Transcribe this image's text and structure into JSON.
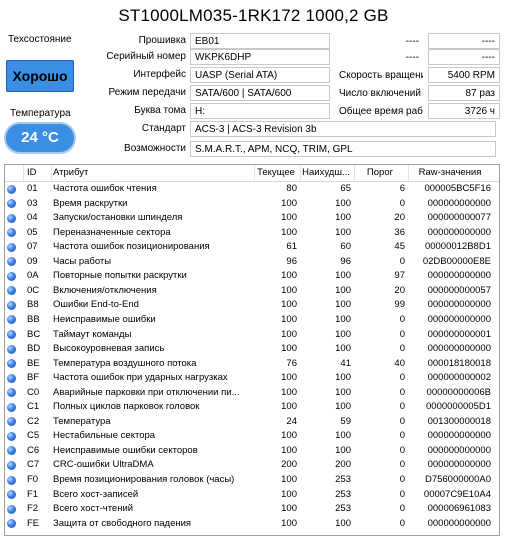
{
  "title": "ST1000LM035-1RK172 1000,2 GB",
  "health": {
    "label": "Техсостояние",
    "status": "Хорошо"
  },
  "temperature": {
    "label": "Температура",
    "value": "24 °C"
  },
  "info_left": [
    {
      "label": "Прошивка",
      "value": "EB01"
    },
    {
      "label": "Серийный номер",
      "value": "WKPK6DHP"
    },
    {
      "label": "Интерфейс",
      "value": "UASP (Serial ATA)"
    },
    {
      "label": "Режим передачи",
      "value": "SATA/600 | SATA/600"
    },
    {
      "label": "Буква тома",
      "value": "H:"
    },
    {
      "label": "Стандарт",
      "value": "ACS-3 | ACS-3 Revision 3b"
    },
    {
      "label": "Возможности",
      "value": "S.M.A.R.T., APM, NCQ, TRIM, GPL"
    }
  ],
  "info_right": [
    {
      "label": "----",
      "value": "----"
    },
    {
      "label": "----",
      "value": "----"
    },
    {
      "label": "Скорость вращения",
      "value": "5400 RPM"
    },
    {
      "label": "Число включений",
      "value": "87 раз"
    },
    {
      "label": "Общее время работы",
      "value": "3726 ч"
    }
  ],
  "table": {
    "headers": {
      "id": "ID",
      "name": "Атрибут",
      "current": "Текущее",
      "worst": "Наихудш...",
      "threshold": "Порог",
      "raw": "Raw-значения"
    },
    "status_icon": "blue-circle-icon",
    "rows": [
      {
        "id": "01",
        "name": "Частота ошибок чтения",
        "current": "80",
        "worst": "65",
        "threshold": "6",
        "raw": "000005BC5F16"
      },
      {
        "id": "03",
        "name": "Время раскрутки",
        "current": "100",
        "worst": "100",
        "threshold": "0",
        "raw": "000000000000"
      },
      {
        "id": "04",
        "name": "Запуски/остановки шпинделя",
        "current": "100",
        "worst": "100",
        "threshold": "20",
        "raw": "000000000077"
      },
      {
        "id": "05",
        "name": "Переназначенные сектора",
        "current": "100",
        "worst": "100",
        "threshold": "36",
        "raw": "000000000000"
      },
      {
        "id": "07",
        "name": "Частота ошибок позиционирования",
        "current": "61",
        "worst": "60",
        "threshold": "45",
        "raw": "00000012B8D1"
      },
      {
        "id": "09",
        "name": "Часы работы",
        "current": "96",
        "worst": "96",
        "threshold": "0",
        "raw": "02DB00000E8E"
      },
      {
        "id": "0A",
        "name": "Повторные попытки раскрутки",
        "current": "100",
        "worst": "100",
        "threshold": "97",
        "raw": "000000000000"
      },
      {
        "id": "0C",
        "name": "Включения/отключения",
        "current": "100",
        "worst": "100",
        "threshold": "20",
        "raw": "000000000057"
      },
      {
        "id": "B8",
        "name": "Ошибки End-to-End",
        "current": "100",
        "worst": "100",
        "threshold": "99",
        "raw": "000000000000"
      },
      {
        "id": "BB",
        "name": "Неисправимые ошибки",
        "current": "100",
        "worst": "100",
        "threshold": "0",
        "raw": "000000000000"
      },
      {
        "id": "BC",
        "name": "Таймаут команды",
        "current": "100",
        "worst": "100",
        "threshold": "0",
        "raw": "000000000001"
      },
      {
        "id": "BD",
        "name": "Высокоуровневая запись",
        "current": "100",
        "worst": "100",
        "threshold": "0",
        "raw": "000000000000"
      },
      {
        "id": "BE",
        "name": "Температура воздушного потока",
        "current": "76",
        "worst": "41",
        "threshold": "40",
        "raw": "000018180018"
      },
      {
        "id": "BF",
        "name": "Частота ошибок при ударных нагрузках",
        "current": "100",
        "worst": "100",
        "threshold": "0",
        "raw": "000000000002"
      },
      {
        "id": "C0",
        "name": "Аварийные парковки при отключении пи...",
        "current": "100",
        "worst": "100",
        "threshold": "0",
        "raw": "00000000006B"
      },
      {
        "id": "C1",
        "name": "Полных циклов парковок головок",
        "current": "100",
        "worst": "100",
        "threshold": "0",
        "raw": "0000000005D1"
      },
      {
        "id": "C2",
        "name": "Температура",
        "current": "24",
        "worst": "59",
        "threshold": "0",
        "raw": "001300000018"
      },
      {
        "id": "C5",
        "name": "Нестабильные сектора",
        "current": "100",
        "worst": "100",
        "threshold": "0",
        "raw": "000000000000"
      },
      {
        "id": "C6",
        "name": "Неисправимые ошибки секторов",
        "current": "100",
        "worst": "100",
        "threshold": "0",
        "raw": "000000000000"
      },
      {
        "id": "C7",
        "name": "CRC-ошибки UltraDMA",
        "current": "200",
        "worst": "200",
        "threshold": "0",
        "raw": "000000000000"
      },
      {
        "id": "F0",
        "name": "Время позиционирования головок (часы)",
        "current": "100",
        "worst": "253",
        "threshold": "0",
        "raw": "D756000000A0"
      },
      {
        "id": "F1",
        "name": "Всего хост-записей",
        "current": "100",
        "worst": "253",
        "threshold": "0",
        "raw": "00007C9E10A4"
      },
      {
        "id": "F2",
        "name": "Всего хост-чтений",
        "current": "100",
        "worst": "253",
        "threshold": "0",
        "raw": "000006961083"
      },
      {
        "id": "FE",
        "name": "Защита от свободного падения",
        "current": "100",
        "worst": "100",
        "threshold": "0",
        "raw": "000000000000"
      }
    ]
  }
}
